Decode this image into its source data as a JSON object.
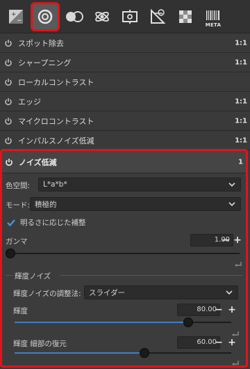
{
  "toolbar": {
    "icons": [
      {
        "name": "basic-adjust-icon"
      },
      {
        "name": "correction-icon",
        "active": true
      },
      {
        "name": "color-icon"
      },
      {
        "name": "effect-icon"
      },
      {
        "name": "transform-icon"
      },
      {
        "name": "raw-icon"
      },
      {
        "name": "pixel-shift-icon"
      },
      {
        "name": "meta-icon",
        "label": "META"
      }
    ]
  },
  "modules": [
    {
      "label": "スポット除去",
      "num": "1:1"
    },
    {
      "label": "シャープニング",
      "num": "1:1"
    },
    {
      "label": "ローカルコントラスト",
      "num": ""
    },
    {
      "label": "エッジ",
      "num": "1:1"
    },
    {
      "label": "マイクロコントラスト",
      "num": "1:1"
    },
    {
      "label": "インパルスノイズ低減",
      "num": "1:1"
    }
  ],
  "noise": {
    "title": "ノイズ低減",
    "num": "1",
    "colorspace_label": "色空間:",
    "colorspace_value": "L*a*b*",
    "mode_label": "モード:",
    "mode_value": "積極的",
    "checkbox_label": "明るさに応じた補整",
    "gamma_label": "ガンマ",
    "gamma_value": "1.00",
    "gamma_fraction": 0.0,
    "section_title": "輝度ノイズ",
    "method_label": "輝度ノイズの調整法:",
    "method_value": "スライダー",
    "lum_label": "輝度",
    "lum_value": "80.00",
    "lum_fraction": 0.8,
    "detail_label": "輝度 細部の復元",
    "detail_value": "60.00",
    "detail_fraction": 0.6
  },
  "colors": {
    "accent_red": "#e0141a",
    "slider_blue": "#3f7fc4"
  }
}
